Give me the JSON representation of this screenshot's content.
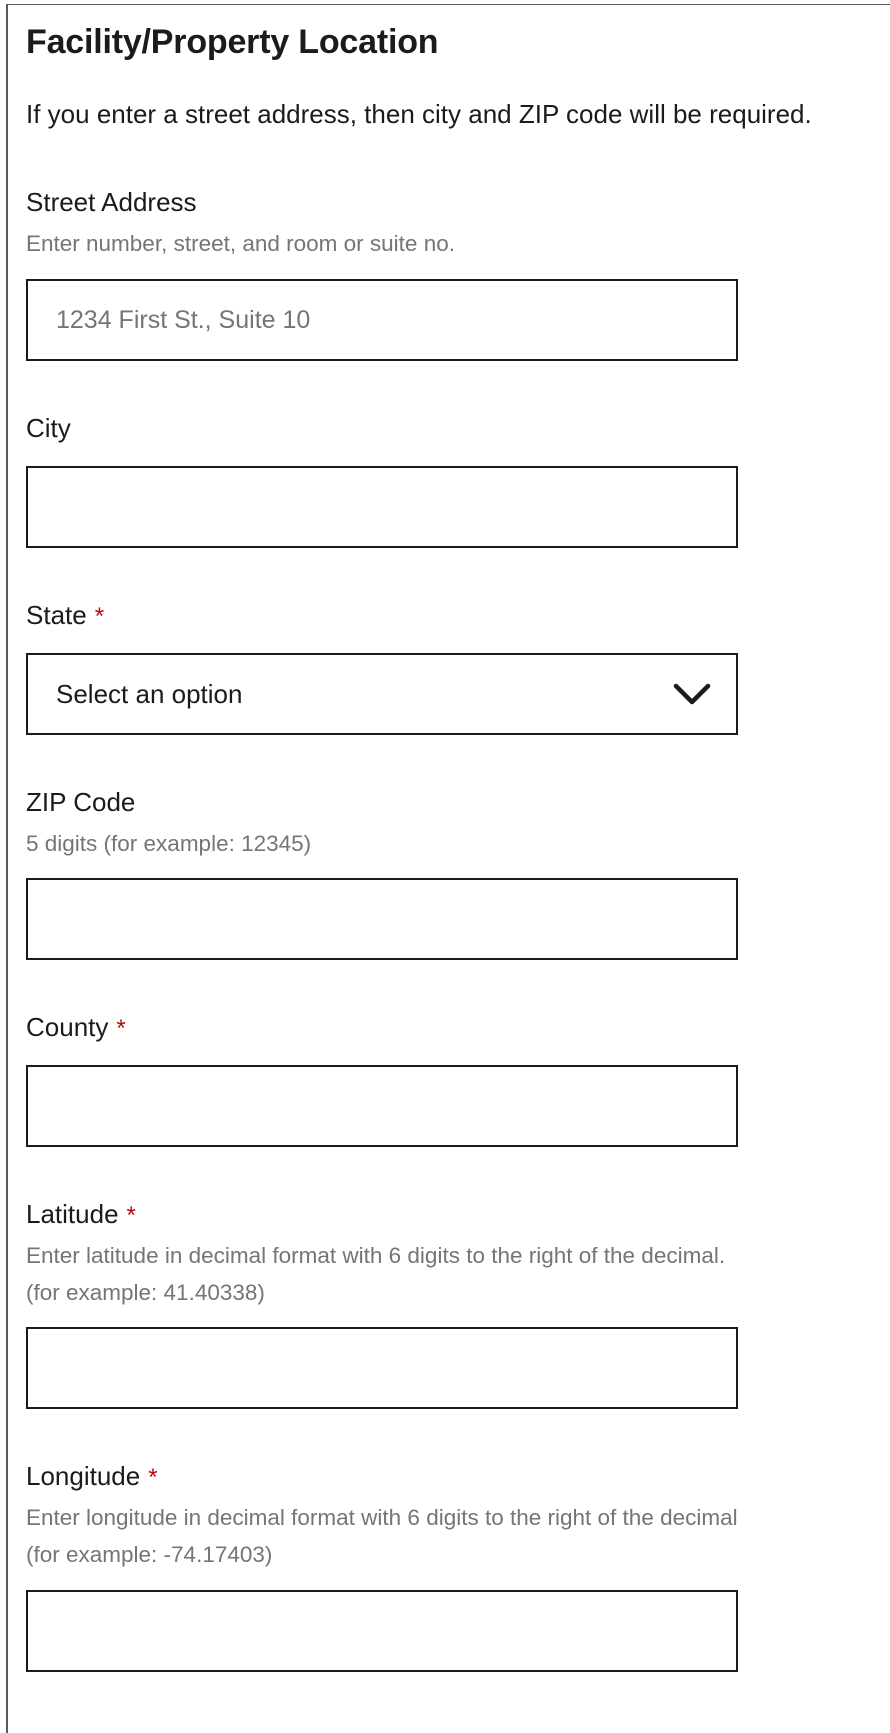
{
  "section": {
    "title": "Facility/Property Location",
    "intro": "If you enter a street address, then city and ZIP code will be required."
  },
  "fields": {
    "street": {
      "label": "Street Address",
      "hint": "Enter number, street, and room or suite no.",
      "value": "",
      "placeholder": "1234 First St., Suite 10"
    },
    "city": {
      "label": "City",
      "value": ""
    },
    "state": {
      "label": "State",
      "required_marker": "*",
      "selected": "Select an option"
    },
    "zip": {
      "label": "ZIP Code",
      "hint": "5 digits (for example: 12345)",
      "value": ""
    },
    "county": {
      "label": "County",
      "required_marker": "*",
      "value": ""
    },
    "latitude": {
      "label": "Latitude",
      "required_marker": "*",
      "hint": "Enter latitude in decimal format with 6 digits to the right of the decimal. (for example: 41.40338)",
      "value": ""
    },
    "longitude": {
      "label": "Longitude",
      "required_marker": "*",
      "hint": "Enter longitude in decimal format with  6 digits to the right of the decimal (for example: -74.17403)",
      "value": ""
    }
  },
  "icons": {
    "state_select": "chevron-down-icon"
  },
  "colors": {
    "required": "#b50909",
    "hint_text": "#71767a",
    "border": "#1b1b1b"
  }
}
